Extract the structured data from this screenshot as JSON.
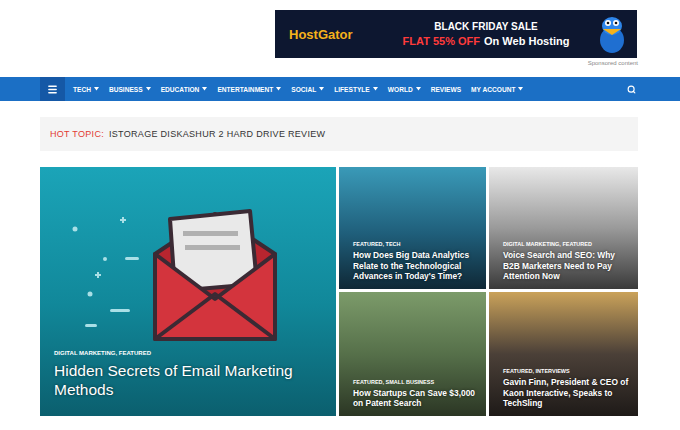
{
  "ad": {
    "brand": "HostGator",
    "headline": "BLACK FRIDAY SALE",
    "offer": "FLAT 55% OFF",
    "offer_rest": "On Web Hosting",
    "label": "Sponsored content"
  },
  "nav": {
    "items": [
      {
        "label": "TECH",
        "dropdown": true
      },
      {
        "label": "BUSINESS",
        "dropdown": true
      },
      {
        "label": "EDUCATION",
        "dropdown": true
      },
      {
        "label": "ENTERTAINMENT",
        "dropdown": true
      },
      {
        "label": "SOCIAL",
        "dropdown": true
      },
      {
        "label": "LIFESTYLE",
        "dropdown": true
      },
      {
        "label": "WORLD",
        "dropdown": true
      },
      {
        "label": "REVIEWS",
        "dropdown": false
      },
      {
        "label": "MY ACCOUNT",
        "dropdown": true
      }
    ]
  },
  "hot_topic": {
    "label": "HOT TOPIC:",
    "text": "ISTORAGE DISKASHUR 2 HARD DRIVE REVIEW"
  },
  "cards": [
    {
      "kind": "large",
      "categories": "DIGITAL MARKETING, FEATURED",
      "title": "Hidden Secrets of Email Marketing Methods"
    },
    {
      "kind": "small",
      "categories": "FEATURED, TECH",
      "title": "How Does Big Data Analytics Relate to the Technological Advances in Today's Time?"
    },
    {
      "kind": "small",
      "categories": "DIGITAL MARKETING, FEATURED",
      "title": "Voice Search and SEO: Why B2B Marketers Need to Pay Attention Now"
    },
    {
      "kind": "small",
      "categories": "FEATURED, SMALL BUSINESS",
      "title": "How Startups Can Save $3,000 on Patent Search"
    },
    {
      "kind": "small",
      "categories": "FEATURED, INTERVIEWS",
      "title": "Gavin Finn, President & CEO of Kaon Interactive, Speaks to TechSling"
    }
  ]
}
